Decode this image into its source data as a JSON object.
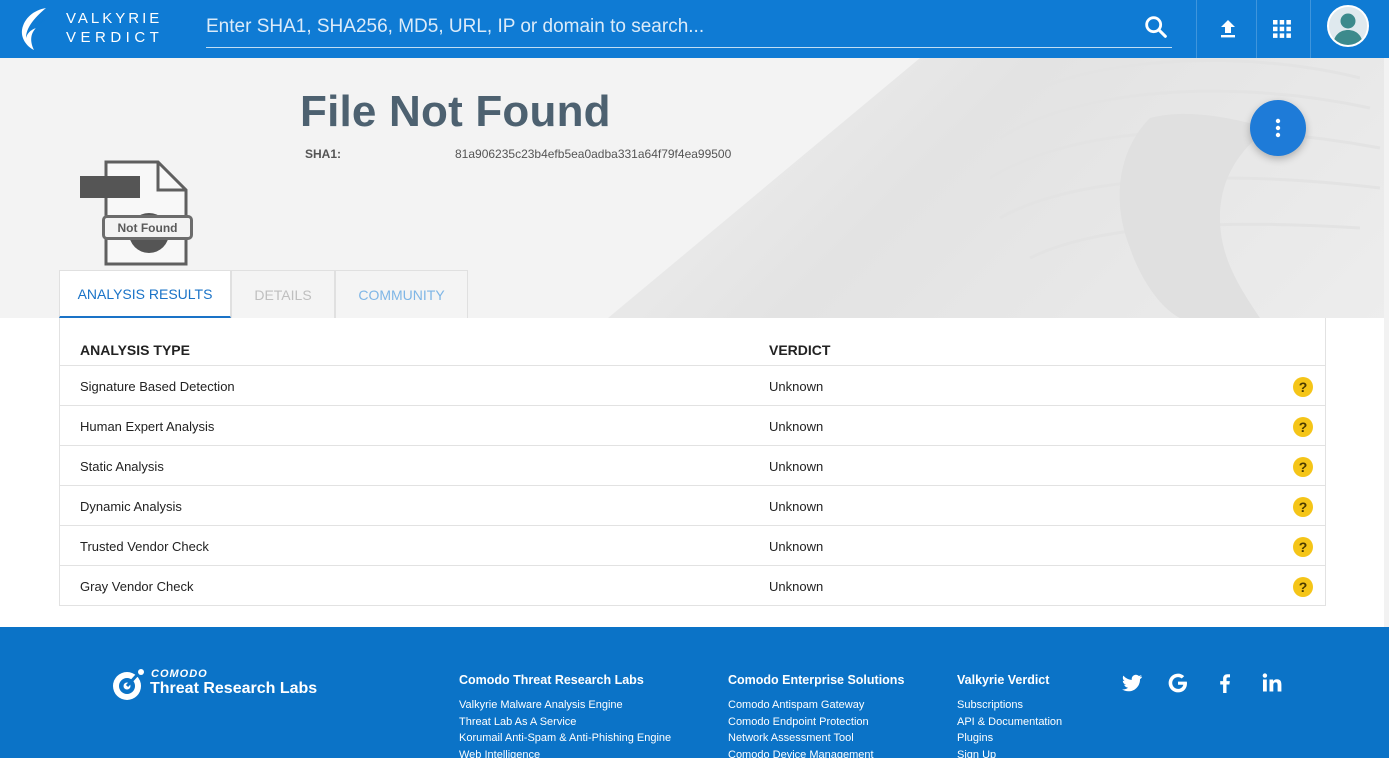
{
  "app": {
    "logo_line1": "VALKYRIE",
    "logo_line2": "VERDICT"
  },
  "search": {
    "placeholder": "Enter SHA1, SHA256, MD5, URL, IP or domain to search...",
    "value": ""
  },
  "header_icons": [
    "search-icon",
    "upload-icon",
    "apps-grid-icon",
    "user-avatar"
  ],
  "file": {
    "title": "File Not Found",
    "status_badge": "Not Found",
    "hash_label": "SHA1:",
    "hash_value": "81a906235c23b4efb5ea0adba331a64f79f4ea99500"
  },
  "tabs": [
    {
      "label": "ANALYSIS RESULTS",
      "active": true
    },
    {
      "label": "DETAILS",
      "active": false
    },
    {
      "label": "COMMUNITY",
      "active": false
    }
  ],
  "table": {
    "headers": [
      "ANALYSIS TYPE",
      "VERDICT"
    ],
    "rows": [
      {
        "type": "Signature Based Detection",
        "verdict": "Unknown"
      },
      {
        "type": "Human Expert Analysis",
        "verdict": "Unknown"
      },
      {
        "type": "Static Analysis",
        "verdict": "Unknown"
      },
      {
        "type": "Dynamic Analysis",
        "verdict": "Unknown"
      },
      {
        "type": "Trusted Vendor Check",
        "verdict": "Unknown"
      },
      {
        "type": "Gray Vendor Check",
        "verdict": "Unknown"
      }
    ]
  },
  "footer": {
    "brand_small": "COMODO",
    "brand_big": "Threat Research Labs",
    "columns": [
      {
        "title": "Comodo Threat Research Labs",
        "links": [
          "Valkyrie Malware Analysis Engine",
          "Threat Lab As A Service",
          "Korumail Anti-Spam & Anti-Phishing Engine",
          "Web Intelligence"
        ]
      },
      {
        "title": "Comodo Enterprise Solutions",
        "links": [
          "Comodo Antispam Gateway",
          "Comodo Endpoint Protection",
          "Network Assessment Tool",
          "Comodo Device Management"
        ]
      },
      {
        "title": "Valkyrie Verdict",
        "links": [
          "Subscriptions",
          "API & Documentation",
          "Plugins",
          "Sign Up"
        ]
      }
    ],
    "social_icons": [
      "twitter-icon",
      "google-icon",
      "facebook-icon",
      "linkedin-icon"
    ]
  },
  "colors": {
    "header_blue": "#0f7bd4",
    "footer_blue": "#0b73c7",
    "title_slate": "#4d6170",
    "tab_active": "#1a73c7",
    "unknown_yellow": "#f5c518",
    "fab_blue": "#1e7bd8"
  }
}
